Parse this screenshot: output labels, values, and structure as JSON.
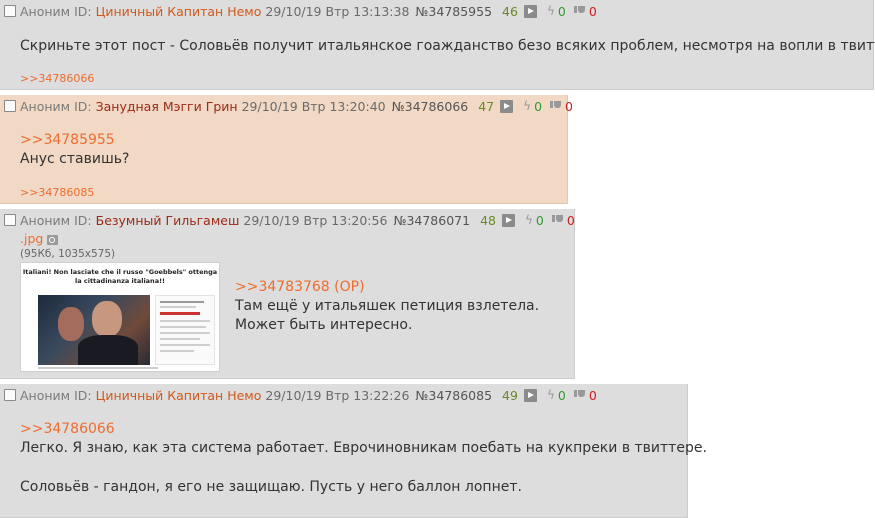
{
  "posts": [
    {
      "name": "Аноним",
      "id_label": "ID:",
      "poster_id": "Циничный Капитан Немо",
      "datetime": "29/10/19 Втр 13:13:38",
      "number": "№34785955",
      "count": "46",
      "likes": "0",
      "dislikes": "0",
      "message": "Скриньте этот пост - Соловьёв получит итальянское гоажданство безо всяких проблем, несмотря на вопли в твиттере.",
      "replies": ">>34786066"
    },
    {
      "name": "Аноним",
      "id_label": "ID:",
      "poster_id": "Занудная Мэгги Грин",
      "datetime": "29/10/19 Втр 13:20:40",
      "number": "№34786066",
      "count": "47",
      "likes": "0",
      "dislikes": "0",
      "quote": ">>34785955",
      "message": "Анус ставишь?",
      "replies": ">>34786085"
    },
    {
      "name": "Аноним",
      "id_label": "ID:",
      "poster_id": "Безумный Гильгамеш",
      "datetime": "29/10/19 Втр 13:20:56",
      "number": "№34786071",
      "count": "48",
      "likes": "0",
      "dislikes": "0",
      "file_name": ".jpg",
      "file_info": "(95Кб, 1035x575)",
      "image_title": "Italiani! Non lasciate che il russo \"Goebbels\" ottenga la cittadinanza italiana!!",
      "quote": ">>34783768 (OP)",
      "message_lines": [
        "Там ещё у итальяшек петиция взлетела.",
        "Может быть интересно."
      ]
    },
    {
      "name": "Аноним",
      "id_label": "ID:",
      "poster_id": "Циничный Капитан Немо",
      "datetime": "29/10/19 Втр 13:22:26",
      "number": "№34786085",
      "count": "49",
      "likes": "0",
      "dislikes": "0",
      "quote": ">>34786066",
      "message_lines": [
        "Легко. Я знаю, как эта система работает. Еврочиновникам поебать на кукпреки в твиттере.",
        "Соловьёв - гандон, я его не защищаю. Пусть у него баллон лопнет."
      ]
    }
  ],
  "colors": {
    "post_bg": "#dddddd",
    "highlight_bg": "#f1d9c5",
    "link": "#ef6c2f",
    "likes": "#339a33",
    "dislikes": "#cc2222",
    "count": "#6a8a27"
  }
}
